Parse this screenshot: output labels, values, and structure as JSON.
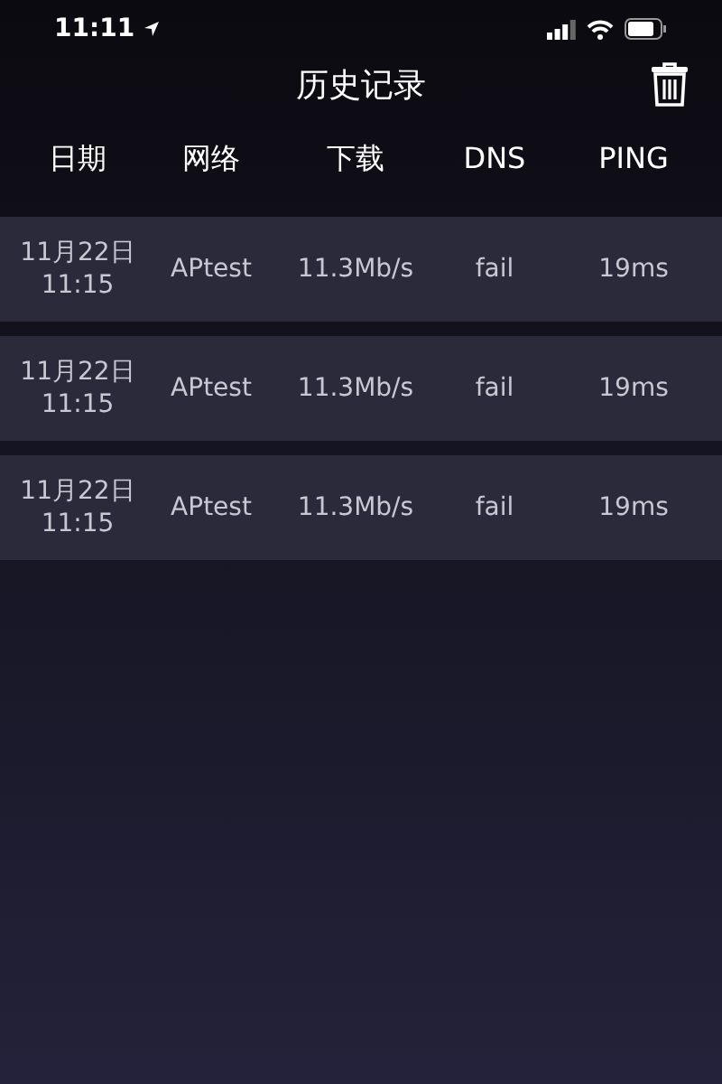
{
  "status_bar": {
    "time": "11:11"
  },
  "nav": {
    "title": "历史记录"
  },
  "table": {
    "columns": [
      "日期",
      "网络",
      "下载",
      "DNS",
      "PING"
    ],
    "rows": [
      {
        "date": "11月22日",
        "time": "11:15",
        "network": "APtest",
        "download": "11.3Mb/s",
        "dns": "fail",
        "ping": "19ms"
      },
      {
        "date": "11月22日",
        "time": "11:15",
        "network": "APtest",
        "download": "11.3Mb/s",
        "dns": "fail",
        "ping": "19ms"
      },
      {
        "date": "11月22日",
        "time": "11:15",
        "network": "APtest",
        "download": "11.3Mb/s",
        "dns": "fail",
        "ping": "19ms"
      }
    ]
  }
}
